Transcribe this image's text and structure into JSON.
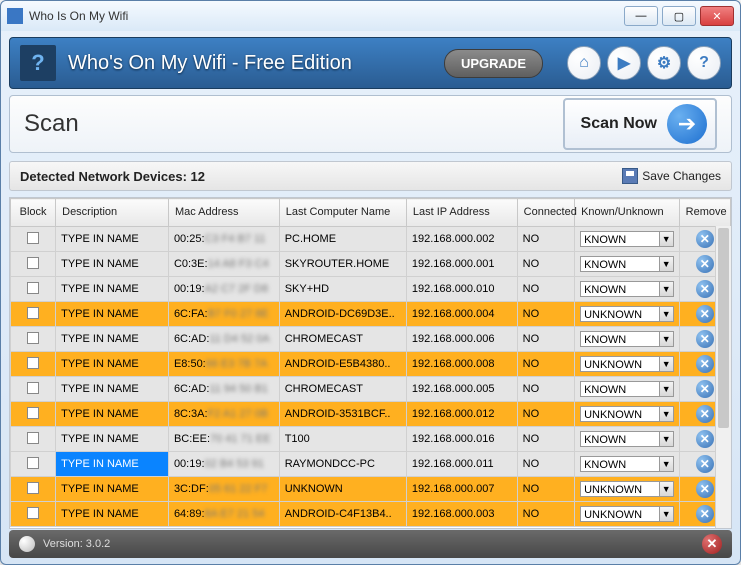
{
  "window": {
    "title": "Who Is On My Wifi"
  },
  "toolbar": {
    "product_title": "Who's On My Wifi -  Free Edition",
    "upgrade": "UPGRADE",
    "icons": {
      "home": "⌂",
      "play": "▶",
      "gears": "⚙",
      "help": "?"
    }
  },
  "scan": {
    "label": "Scan",
    "button": "Scan Now"
  },
  "detected": {
    "label": "Detected Network Devices: 12",
    "save": "Save Changes"
  },
  "columns": {
    "block": "Block",
    "desc": "Description",
    "mac": "Mac Address",
    "comp": "Last Computer Name",
    "ip": "Last IP Address",
    "conn": "Connected",
    "ku": "Known/Unknown",
    "remove": "Remove"
  },
  "rows": [
    {
      "desc": "TYPE IN NAME",
      "mac_prefix": "00:25",
      "mac_rest": "C3 F4 B7 11",
      "comp": "PC.HOME",
      "ip": "192.168.000.002",
      "conn": "NO",
      "ku": "KNOWN",
      "class": "known"
    },
    {
      "desc": "TYPE IN NAME",
      "mac_prefix": "C0:3E",
      "mac_rest": "14 A8 F3 C4",
      "comp": "SKYROUTER.HOME",
      "ip": "192.168.000.001",
      "conn": "NO",
      "ku": "KNOWN",
      "class": "known"
    },
    {
      "desc": "TYPE IN NAME",
      "mac_prefix": "00:19",
      "mac_rest": "A2 C7 2F D8",
      "comp": "SKY+HD",
      "ip": "192.168.000.010",
      "conn": "NO",
      "ku": "KNOWN",
      "class": "known"
    },
    {
      "desc": "TYPE IN NAME",
      "mac_prefix": "6C:FA",
      "mac_rest": "B7 F0 27 8E",
      "comp": "ANDROID-DC69D3E..",
      "ip": "192.168.000.004",
      "conn": "NO",
      "ku": "UNKNOWN",
      "class": "unknown"
    },
    {
      "desc": "TYPE IN NAME",
      "mac_prefix": "6C:AD",
      "mac_rest": "11 D4 52 0A",
      "comp": "CHROMECAST",
      "ip": "192.168.000.006",
      "conn": "NO",
      "ku": "KNOWN",
      "class": "known"
    },
    {
      "desc": "TYPE IN NAME",
      "mac_prefix": "E8:50",
      "mac_rest": "66 E3 7B 7A",
      "comp": "ANDROID-E5B4380..",
      "ip": "192.168.000.008",
      "conn": "NO",
      "ku": "UNKNOWN",
      "class": "unknown"
    },
    {
      "desc": "TYPE IN NAME",
      "mac_prefix": "6C:AD",
      "mac_rest": "11 94 50 B1",
      "comp": "CHROMECAST",
      "ip": "192.168.000.005",
      "conn": "NO",
      "ku": "KNOWN",
      "class": "known"
    },
    {
      "desc": "TYPE IN NAME",
      "mac_prefix": "8C:3A",
      "mac_rest": "F2 A1 27 0B",
      "comp": "ANDROID-3531BCF..",
      "ip": "192.168.000.012",
      "conn": "NO",
      "ku": "UNKNOWN",
      "class": "unknown"
    },
    {
      "desc": "TYPE IN NAME",
      "mac_prefix": "BC:EE",
      "mac_rest": "70 41 71 EE",
      "comp": "T100",
      "ip": "192.168.000.016",
      "conn": "NO",
      "ku": "KNOWN",
      "class": "known"
    },
    {
      "desc": "TYPE IN NAME",
      "mac_prefix": "00:19",
      "mac_rest": "02 B4 53 91",
      "comp": "RAYMONDCC-PC",
      "ip": "192.168.000.011",
      "conn": "NO",
      "ku": "KNOWN",
      "class": "known selected"
    },
    {
      "desc": "TYPE IN NAME",
      "mac_prefix": "3C:DF",
      "mac_rest": "05 61 22 F7",
      "comp": "UNKNOWN",
      "ip": "192.168.000.007",
      "conn": "NO",
      "ku": "UNKNOWN",
      "class": "unknown"
    },
    {
      "desc": "TYPE IN NAME",
      "mac_prefix": "64:89",
      "mac_rest": "8A E7 21 54",
      "comp": "ANDROID-C4F13B4..",
      "ip": "192.168.000.003",
      "conn": "NO",
      "ku": "UNKNOWN",
      "class": "unknown"
    }
  ],
  "status": {
    "version": "Version: 3.0.2"
  }
}
